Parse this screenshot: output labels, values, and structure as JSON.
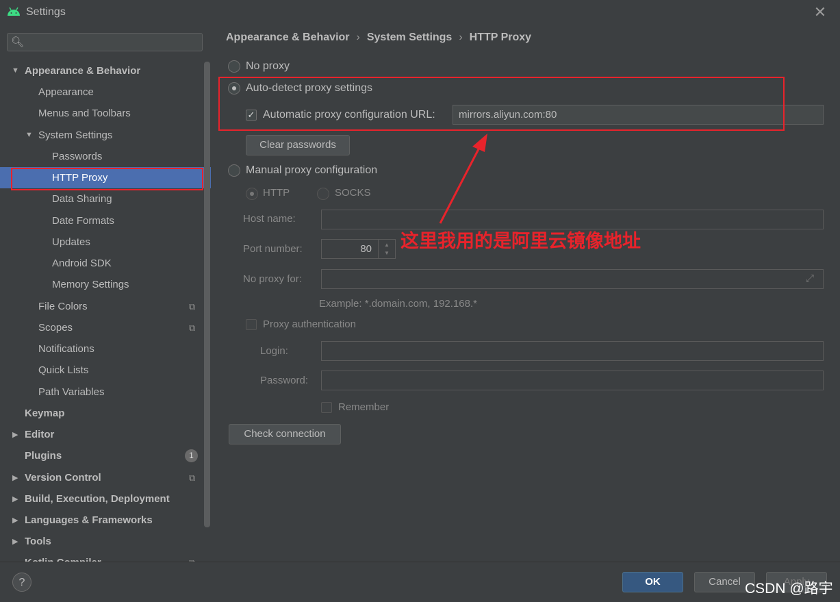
{
  "window": {
    "title": "Settings",
    "app_icon": "android-icon",
    "close_icon": "close-icon"
  },
  "search": {
    "icon": "search-icon",
    "placeholder": ""
  },
  "sidebar": {
    "appearance_behavior": "Appearance & Behavior",
    "appearance": "Appearance",
    "menus_toolbars": "Menus and Toolbars",
    "system_settings": "System Settings",
    "passwords": "Passwords",
    "http_proxy": "HTTP Proxy",
    "data_sharing": "Data Sharing",
    "date_formats": "Date Formats",
    "updates": "Updates",
    "android_sdk": "Android SDK",
    "memory_settings": "Memory Settings",
    "file_colors": "File Colors",
    "scopes": "Scopes",
    "notifications": "Notifications",
    "quick_lists": "Quick Lists",
    "path_variables": "Path Variables",
    "keymap": "Keymap",
    "editor": "Editor",
    "plugins": "Plugins",
    "plugins_badge": "1",
    "version_control": "Version Control",
    "build_execution": "Build, Execution, Deployment",
    "languages_frameworks": "Languages & Frameworks",
    "tools": "Tools",
    "kotlin_compiler": "Kotlin Compiler"
  },
  "breadcrumb": [
    "Appearance & Behavior",
    "System Settings",
    "HTTP Proxy"
  ],
  "breadcrumb_sep": "›",
  "proxy": {
    "no_proxy": "No proxy",
    "auto_detect": "Auto-detect proxy settings",
    "auto_url_label": "Automatic proxy configuration URL:",
    "auto_url_value": "mirrors.aliyun.com:80",
    "clear_passwords": "Clear passwords",
    "manual": "Manual proxy configuration",
    "http": "HTTP",
    "socks": "SOCKS",
    "host_label": "Host name:",
    "host_value": "",
    "port_label": "Port number:",
    "port_value": "80",
    "no_proxy_for_label": "No proxy for:",
    "no_proxy_for_value": "",
    "example": "Example: *.domain.com, 192.168.*",
    "proxy_auth": "Proxy authentication",
    "login_label": "Login:",
    "password_label": "Password:",
    "remember": "Remember",
    "check_connection": "Check connection",
    "selected_option": "auto-detect",
    "auto_url_checked": true
  },
  "annotation": "这里我用的是阿里云镜像地址",
  "footer": {
    "help": "?",
    "ok": "OK",
    "cancel": "Cancel",
    "apply": "Apply"
  },
  "watermark": "CSDN @路宇",
  "colors": {
    "background": "#3c3f41",
    "selection": "#4b6eaf",
    "annotation_red": "#e8232b",
    "ok_button": "#365880"
  }
}
